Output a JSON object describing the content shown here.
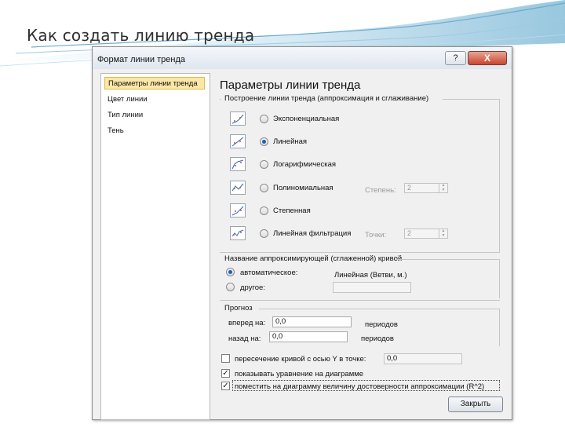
{
  "slide": {
    "title": "Как создать линию тренда"
  },
  "dialog": {
    "title": "Формат линии тренда",
    "help_label": "?",
    "close_label": "X",
    "nav": [
      {
        "label": "Параметры линии тренда"
      },
      {
        "label": "Цвет линии"
      },
      {
        "label": "Тип линии"
      },
      {
        "label": "Тень"
      }
    ],
    "section_title": "Параметры линии тренда",
    "trend_group_label": "Построение линии тренда (аппроксимация и сглаживание)",
    "trend_types": [
      {
        "label": "Экспоненциальная"
      },
      {
        "label": "Линейная"
      },
      {
        "label": "Логарифмическая"
      },
      {
        "label": "Полиномиальная"
      },
      {
        "label": "Степенная"
      },
      {
        "label": "Линейная фильтрация"
      }
    ],
    "degree_label": "Степень:",
    "degree_value": "2",
    "points_label": "Точки:",
    "points_value": "2",
    "name_group_label": "Название аппроксимирующей (сглаженной) кривой",
    "name_auto_label": "автоматическое:",
    "name_auto_value": "Линейная (Ветви, м.)",
    "name_custom_label": "другое:",
    "name_custom_value": "",
    "forecast_label": "Прогноз",
    "forward_label": "вперед на:",
    "forward_value": "0,0",
    "backward_label": "назад на:",
    "backward_value": "0,0",
    "periods_label": "периодов",
    "intercept_label": "пересечение кривой с осью Y в точке:",
    "intercept_value": "0,0",
    "show_equation_label": "показывать уравнение на диаграмме",
    "show_r2_label": "поместить на диаграмму величину достоверности аппроксимации (R^2)",
    "close_button_label": "Закрыть"
  }
}
